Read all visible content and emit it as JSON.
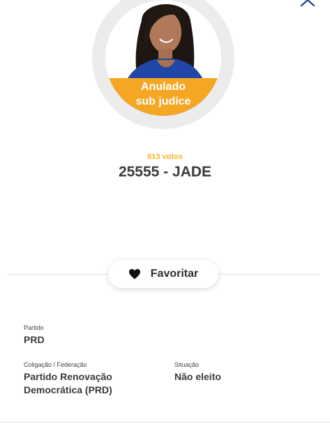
{
  "header": {
    "close_icon": "close-icon"
  },
  "candidate": {
    "photo_icon": "candidate-photo",
    "status_line1": "Anulado",
    "status_line2": "sub judice",
    "votes": "813 votos",
    "title": "25555 - JADE"
  },
  "favorite": {
    "label": "Favoritar",
    "icon": "heart-icon"
  },
  "details": {
    "partido_label": "Partido",
    "partido_value": "PRD",
    "coligacao_label": "Coligação / Federação",
    "coligacao_value_line1": "Partido Renovação",
    "coligacao_value_line2": "Democrática (PRD)",
    "situacao_label": "Situação",
    "situacao_value": "Não eleito"
  },
  "colors": {
    "status_accent": "#f5a623",
    "votes_accent": "#f5b51f",
    "text_dark": "#3a3a3a",
    "close_icon": "#1f3f8f"
  }
}
